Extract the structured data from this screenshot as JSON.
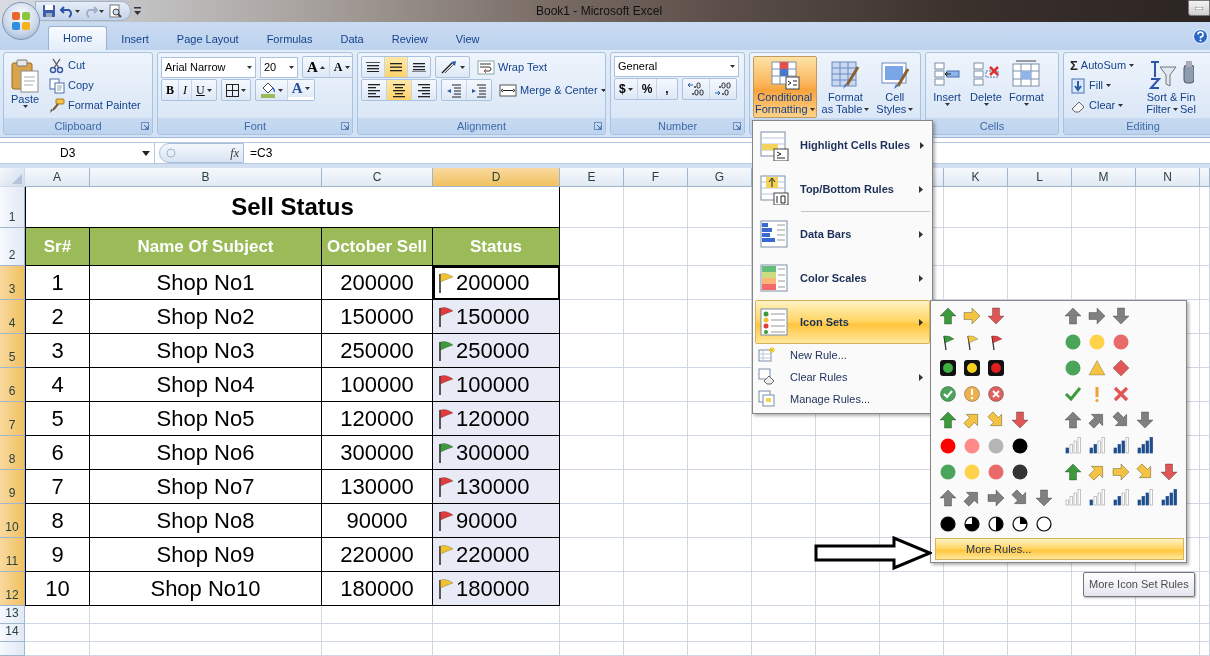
{
  "window": {
    "title": "Book1 - Microsoft Excel"
  },
  "tabs": [
    {
      "label": "Home",
      "selected": true
    },
    {
      "label": "Insert",
      "selected": false
    },
    {
      "label": "Page Layout",
      "selected": false
    },
    {
      "label": "Formulas",
      "selected": false
    },
    {
      "label": "Data",
      "selected": false
    },
    {
      "label": "Review",
      "selected": false
    },
    {
      "label": "View",
      "selected": false
    }
  ],
  "ribbon": {
    "clipboard": {
      "label": "Clipboard",
      "paste": "Paste",
      "cut": "Cut",
      "copy": "Copy",
      "format_painter": "Format Painter"
    },
    "font": {
      "label": "Font",
      "font_name": "Arial Narrow",
      "font_size": "20",
      "grow_font": "A",
      "shrink_font": "A",
      "bold": "B",
      "italic": "I",
      "underline": "U",
      "font_color": "A"
    },
    "alignment": {
      "label": "Alignment",
      "vertical_align": [
        {
          "selected": false
        },
        {
          "selected": true
        },
        {
          "selected": false
        }
      ],
      "horizontal_align": [
        {
          "selected": false
        },
        {
          "selected": true
        },
        {
          "selected": false
        }
      ],
      "wrap_text": "Wrap Text",
      "merge_center": "Merge & Center"
    },
    "number": {
      "label": "Number",
      "format": "General",
      "currency": "$",
      "percent": "%",
      "comma": ","
    },
    "styles": {
      "conditional_formatting": {
        "lines": [
          "Conditional",
          "Formatting"
        ],
        "pressed": true
      },
      "format_as_table": [
        "Format",
        "as Table"
      ],
      "cell_styles": [
        "Cell",
        "Styles"
      ]
    },
    "cells": {
      "label": "Cells",
      "insert": "Insert",
      "delete": "Delete",
      "format": "Format"
    },
    "editing": {
      "label": "Editing",
      "autosum_symbol": "Σ",
      "autosum": "AutoSum",
      "fill": "Fill",
      "clear": "Clear",
      "sort_filter": [
        "Sort &",
        "Filter"
      ],
      "find_select": [
        "Fin",
        "Sel"
      ]
    }
  },
  "formula_bar": {
    "name_box": "D3",
    "function_label": "fx",
    "formula": "=C3"
  },
  "sheet": {
    "columns": [
      {
        "letter": "A",
        "selected": false
      },
      {
        "letter": "B",
        "selected": false
      },
      {
        "letter": "C",
        "selected": false
      },
      {
        "letter": "D",
        "selected": true
      },
      {
        "letter": "E",
        "selected": false
      },
      {
        "letter": "F",
        "selected": false
      },
      {
        "letter": "G",
        "selected": false
      },
      {},
      {},
      {
        "selected": false
      },
      {
        "letter": "K",
        "selected": false
      },
      {
        "letter": "L",
        "selected": false
      },
      {
        "letter": "M",
        "selected": false
      },
      {
        "letter": "N",
        "selected": false
      },
      {
        "selected": false
      }
    ],
    "rows": [
      {
        "number": "1",
        "selected": false
      },
      {
        "number": "2",
        "selected": false
      },
      {
        "number": "3",
        "selected": true
      },
      {
        "number": "4",
        "selected": true
      },
      {
        "number": "5",
        "selected": true
      },
      {
        "number": "6",
        "selected": true
      },
      {
        "number": "7",
        "selected": true
      },
      {
        "number": "8",
        "selected": true
      },
      {
        "number": "9",
        "selected": true
      },
      {
        "number": "10",
        "selected": true
      },
      {
        "number": "11",
        "selected": true
      },
      {
        "number": "12",
        "selected": true
      },
      {
        "number": "13",
        "selected": false
      },
      {
        "number": "14",
        "selected": false
      }
    ]
  },
  "table": {
    "title": "Sell Status",
    "headers": [
      "Sr#",
      "Name Of  Subject",
      "October Sell",
      "Status"
    ],
    "records": [
      {
        "sr": "1",
        "name": "Shop No1",
        "sell": "200000",
        "status": "200000",
        "color": "#f2c12e",
        "active": true
      },
      {
        "sr": "2",
        "name": "Shop No2",
        "sell": "150000",
        "status": "150000",
        "color": "#e03c3c",
        "active": false
      },
      {
        "sr": "3",
        "name": "Shop No3",
        "sell": "250000",
        "status": "250000",
        "color": "#3c9a3c",
        "active": false
      },
      {
        "sr": "4",
        "name": "Shop No4",
        "sell": "100000",
        "status": "100000",
        "color": "#e03c3c",
        "active": false
      },
      {
        "sr": "5",
        "name": "Shop No5",
        "sell": "120000",
        "status": "120000",
        "color": "#e03c3c",
        "active": false
      },
      {
        "sr": "6",
        "name": "Shop No6",
        "sell": "300000",
        "status": "300000",
        "color": "#3c9a3c",
        "active": false
      },
      {
        "sr": "7",
        "name": "Shop No7",
        "sell": "130000",
        "status": "130000",
        "color": "#e03c3c",
        "active": false
      },
      {
        "sr": "8",
        "name": "Shop No8",
        "sell": "90000",
        "status": "90000",
        "color": "#e03c3c",
        "active": false
      },
      {
        "sr": "9",
        "name": "Shop No9",
        "sell": "220000",
        "status": "220000",
        "color": "#f2c12e",
        "active": false
      },
      {
        "sr": "10",
        "name": "Shop No10",
        "sell": "180000",
        "status": "180000",
        "color": "#f2c12e",
        "active": false
      }
    ]
  },
  "conditional_menu": {
    "items": [
      {
        "label": "Highlight Cells Rules",
        "kind": "large",
        "submenu": true,
        "selected": false
      },
      {
        "label": "Top/Bottom Rules",
        "kind": "large",
        "submenu": true,
        "selected": false
      },
      {
        "label": "Data Bars",
        "kind": "large",
        "submenu": true,
        "selected": false
      },
      {
        "label": "Color Scales",
        "kind": "large",
        "submenu": true,
        "selected": false
      },
      {
        "label": "Icon Sets",
        "kind": "large",
        "submenu": true,
        "selected": true
      },
      {
        "label": "New Rule...",
        "kind": "small",
        "submenu": false,
        "selected": false
      },
      {
        "label": "Clear Rules",
        "kind": "small",
        "submenu": true,
        "selected": false
      },
      {
        "label": "Manage Rules...",
        "kind": "small",
        "submenu": false,
        "selected": false
      }
    ]
  },
  "icon_sets": {
    "left": [
      [
        {
          "kind": "arrow-up",
          "color": "#3c9a3c"
        },
        {
          "kind": "arrow-right",
          "color": "#f5c342"
        },
        {
          "kind": "arrow-down",
          "color": "#e05555"
        }
      ],
      [
        {
          "kind": "flag",
          "color": "#3c9a3c"
        },
        {
          "kind": "flag",
          "color": "#f0c84a"
        },
        {
          "kind": "flag",
          "color": "#e04040"
        }
      ],
      [
        {
          "kind": "light",
          "color": "#3fae3f"
        },
        {
          "kind": "light",
          "color": "#f5d020"
        },
        {
          "kind": "light",
          "color": "#e02020"
        }
      ],
      [
        {
          "kind": "badge-check",
          "color": "#4aa55a"
        },
        {
          "kind": "badge-excl",
          "color": "#f0b050"
        },
        {
          "kind": "badge-x",
          "color": "#e06060"
        }
      ],
      [
        {
          "kind": "arrow-up",
          "color": "#3c9a3c"
        },
        {
          "kind": "arrow-upright",
          "color": "#f5c342"
        },
        {
          "kind": "arrow-downright",
          "color": "#f5c342"
        },
        {
          "kind": "arrow-down",
          "color": "#e05555"
        }
      ],
      [
        {
          "kind": "circle",
          "color": "#ff0000"
        },
        {
          "kind": "circle",
          "color": "#ff8a8a"
        },
        {
          "kind": "circle",
          "color": "#b5b5b5"
        },
        {
          "kind": "circle",
          "color": "#000000"
        }
      ],
      [
        {
          "kind": "circle",
          "color": "#4aa55a"
        },
        {
          "kind": "circle",
          "color": "#ffd24a"
        },
        {
          "kind": "circle",
          "color": "#e86a6a"
        },
        {
          "kind": "circle",
          "color": "#333333"
        }
      ],
      [
        {
          "kind": "arrow-up",
          "color": "#808080"
        },
        {
          "kind": "arrow-upright",
          "color": "#808080"
        },
        {
          "kind": "arrow-right",
          "color": "#808080"
        },
        {
          "kind": "arrow-downright",
          "color": "#808080"
        },
        {
          "kind": "arrow-down",
          "color": "#808080"
        }
      ],
      [
        {
          "kind": "pie-4"
        },
        {
          "kind": "pie-3"
        },
        {
          "kind": "pie-2"
        },
        {
          "kind": "pie-1"
        },
        {
          "kind": "pie-0"
        }
      ]
    ],
    "right": [
      [
        {
          "kind": "arrow-up",
          "color": "#808080"
        },
        {
          "kind": "arrow-right",
          "color": "#808080"
        },
        {
          "kind": "arrow-down",
          "color": "#808080"
        }
      ],
      [
        {
          "kind": "circle",
          "color": "#4aa55a"
        },
        {
          "kind": "circle",
          "color": "#ffd24a"
        },
        {
          "kind": "circle",
          "color": "#e86a6a"
        }
      ],
      [
        {
          "kind": "circle",
          "color": "#4aa55a"
        },
        {
          "kind": "triangle",
          "color": "#f5c342"
        },
        {
          "kind": "diamond",
          "color": "#e05555"
        }
      ],
      [
        {
          "kind": "check",
          "color": "#3c9a3c"
        },
        {
          "kind": "exclaim",
          "color": "#f0a030"
        },
        {
          "kind": "cross",
          "color": "#e05555"
        }
      ],
      [
        {
          "kind": "arrow-up",
          "color": "#808080"
        },
        {
          "kind": "arrow-upright",
          "color": "#808080"
        },
        {
          "kind": "arrow-downright",
          "color": "#808080"
        },
        {
          "kind": "arrow-down",
          "color": "#808080"
        }
      ],
      [
        {
          "kind": "bars-1"
        },
        {
          "kind": "bars-2"
        },
        {
          "kind": "bars-3"
        },
        {
          "kind": "bars-4"
        }
      ],
      [
        {
          "kind": "arrow-up",
          "color": "#3c9a3c"
        },
        {
          "kind": "arrow-upright",
          "color": "#f5c342"
        },
        {
          "kind": "arrow-right",
          "color": "#f5c342"
        },
        {
          "kind": "arrow-downright",
          "color": "#f5c342"
        },
        {
          "kind": "arrow-down",
          "color": "#e05555"
        }
      ],
      [
        {
          "kind": "bars-0"
        },
        {
          "kind": "bars-1"
        },
        {
          "kind": "bars-2"
        },
        {
          "kind": "bars-3"
        },
        {
          "kind": "bars-4"
        }
      ]
    ],
    "more_rules": {
      "label": "More Rules...",
      "selected": true
    }
  },
  "tooltip": "More Icon Set Rules"
}
